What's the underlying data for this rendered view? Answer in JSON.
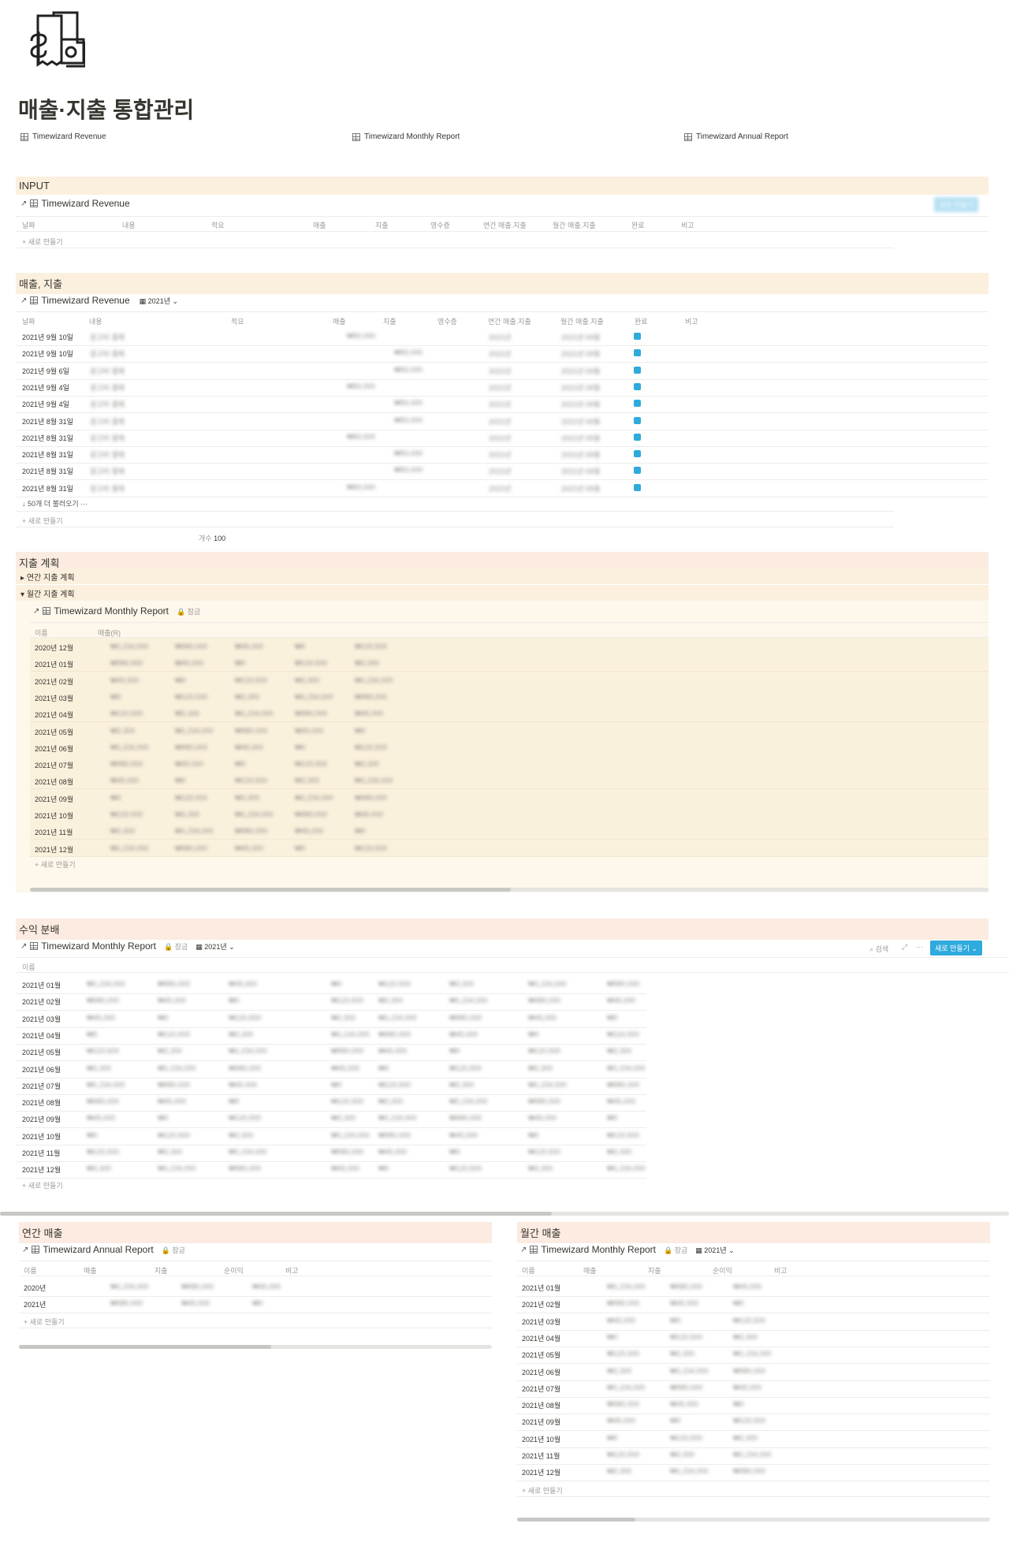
{
  "page": {
    "title": "매출·지출 통합관리",
    "icon": "money-receipt-icon"
  },
  "links": [
    "Timewizard Revenue",
    "Timewizard Monthly Report",
    "Timewizard Annual Report"
  ],
  "input": {
    "section": "INPUT",
    "db": "Timewizard Revenue",
    "cols": [
      "날짜",
      "내용",
      "적요",
      "매출",
      "지출",
      "영수증",
      "연간 매출.지출",
      "월간 매출.지출",
      "완료",
      "비고"
    ],
    "new": "새로 만들기",
    "new_btn": "새로 만들기"
  },
  "revenue": {
    "section": "매출, 지출",
    "db": "Timewizard Revenue",
    "view": "2021년",
    "cols": [
      "날짜",
      "내용",
      "적요",
      "매출",
      "지출",
      "영수증",
      "연간 매출.지출",
      "월간 매출.지출",
      "완료",
      "비고"
    ],
    "dates": [
      "2021년 9월 10일",
      "2021년 9월 10일",
      "2021년 9월 6일",
      "2021년 9월 4일",
      "2021년 9월 4일",
      "2021년 8월 31일",
      "2021년 8월 31일",
      "2021년 8월 31일",
      "2021년 8월 31일",
      "2021년 8월 31일"
    ],
    "more": "50개 더 불러오기",
    "new": "새로 만들기",
    "count_label": "개수",
    "count": "100"
  },
  "plan": {
    "section": "지출 계획",
    "annual": "연간 지출 계획",
    "monthly": "월간 지출 계획",
    "db": "Timewizard Monthly Report",
    "lock": "잠금",
    "cols": [
      "이름",
      "매출(R)"
    ],
    "rows": [
      "2020년 12월",
      "2021년 01월",
      "2021년 02월",
      "2021년 03월",
      "2021년 04월",
      "2021년 05월",
      "2021년 06월",
      "2021년 07월",
      "2021년 08월",
      "2021년 09월",
      "2021년 10월",
      "2021년 11월",
      "2021년 12월"
    ],
    "new": "새로 만들기"
  },
  "profit": {
    "section": "수익 분배",
    "db": "Timewizard Monthly Report",
    "lock": "잠금",
    "view": "2021년",
    "search": "검색",
    "new_btn": "새로 만들기",
    "cols": [
      "이름"
    ],
    "rows": [
      "2021년 01월",
      "2021년 02월",
      "2021년 03월",
      "2021년 04월",
      "2021년 05월",
      "2021년 06월",
      "2021년 07월",
      "2021년 08월",
      "2021년 09월",
      "2021년 10월",
      "2021년 11월",
      "2021년 12월"
    ],
    "new": "새로 만들기"
  },
  "annual": {
    "section": "연간 매출",
    "db": "Timewizard Annual Report",
    "lock": "잠금",
    "cols": [
      "이름",
      "매출",
      "지출",
      "순이익",
      "비고"
    ],
    "rows": [
      "2020년",
      "2021년"
    ],
    "new": "새로 만들기"
  },
  "monthly": {
    "section": "월간 매출",
    "db": "Timewizard Monthly Report",
    "lock": "잠금",
    "view": "2021년",
    "cols": [
      "이름",
      "매출",
      "지출",
      "순이익",
      "비고"
    ],
    "rows": [
      "2021년 01월",
      "2021년 02월",
      "2021년 03월",
      "2021년 04월",
      "2021년 05월",
      "2021년 06월",
      "2021년 07월",
      "2021년 08월",
      "2021년 09월",
      "2021년 10월",
      "2021년 11월",
      "2021년 12월"
    ],
    "new": "새로 만들기"
  },
  "colors": {
    "section_yellow": "#fbf0de",
    "section_pink": "#fbebe1",
    "accent": "#2eaadc"
  }
}
